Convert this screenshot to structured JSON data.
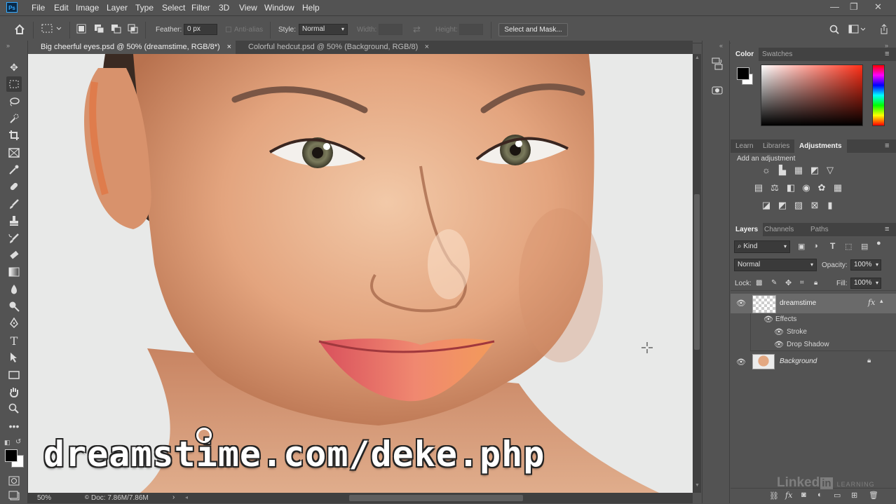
{
  "app": {
    "logo": "Ps"
  },
  "menu": [
    "File",
    "Edit",
    "Image",
    "Layer",
    "Type",
    "Select",
    "Filter",
    "3D",
    "View",
    "Window",
    "Help"
  ],
  "window_controls": {
    "minimize": "—",
    "restore": "❐",
    "close": "✕"
  },
  "options": {
    "feather_label": "Feather:",
    "feather_value": "0 px",
    "antialias_label": "Anti-alias",
    "style_label": "Style:",
    "style_value": "Normal",
    "width_label": "Width:",
    "height_label": "Height:",
    "select_mask_button": "Select and Mask..."
  },
  "tabs": [
    {
      "label": "Big cheerful eyes.psd @ 50% (dreamstime, RGB/8*)",
      "close": "×"
    },
    {
      "label": "Colorful hedcut.psd @ 50% (Background, RGB/8)",
      "close": "×"
    }
  ],
  "tools": [
    "move-icon",
    "marquee-icon",
    "lasso-icon",
    "quick-select-icon",
    "crop-icon",
    "frame-icon",
    "eyedropper-icon",
    "healing-icon",
    "brush-icon",
    "stamp-icon",
    "history-brush-icon",
    "eraser-icon",
    "gradient-icon",
    "blur-icon",
    "dodge-icon",
    "pen-icon",
    "type-icon",
    "path-select-icon",
    "rectangle-icon",
    "hand-icon",
    "zoom-icon",
    "more-icon"
  ],
  "canvas": {
    "watermark": "dreamstime.com/deke.php"
  },
  "status": {
    "zoom": "50%",
    "doc": "Doc: 7.86M/7.86M"
  },
  "color_panel": {
    "tabs": [
      "Color",
      "Swatches"
    ],
    "foreground": "#000000",
    "background": "#ffffff",
    "hue_start": "#ff3a2a"
  },
  "adjust_panel": {
    "tabs": [
      "Learn",
      "Libraries",
      "Adjustments"
    ],
    "hint": "Add an adjustment"
  },
  "layers_panel": {
    "tabs": [
      "Layers",
      "Channels",
      "Paths"
    ],
    "filter_kind": "Kind",
    "blend_mode": "Normal",
    "opacity_label": "Opacity:",
    "opacity_value": "100%",
    "lock_label": "Lock:",
    "fill_label": "Fill:",
    "fill_value": "100%",
    "layers": [
      {
        "name": "dreamstime",
        "fx": "fx",
        "effects_label": "Effects",
        "effects": [
          "Stroke",
          "Drop Shadow"
        ]
      },
      {
        "name": "Background"
      }
    ],
    "footer_icons": [
      "link-icon",
      "fx-icon",
      "mask-icon",
      "adjustment-icon",
      "group-icon",
      "new-layer-icon",
      "trash-icon"
    ]
  },
  "linkedin": {
    "brand": "Linked",
    "in": "in",
    "sub": "LEARNING"
  }
}
